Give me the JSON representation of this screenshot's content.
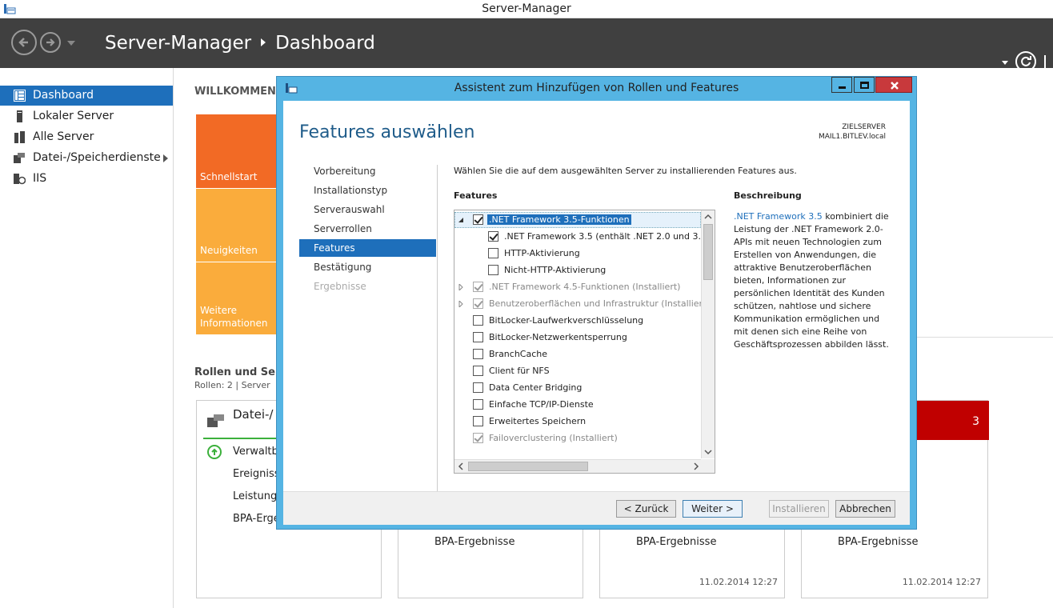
{
  "window": {
    "title": "Server-Manager"
  },
  "header": {
    "breadcrumb_root": "Server-Manager",
    "breadcrumb_page": "Dashboard"
  },
  "sidebar": {
    "items": [
      {
        "label": "Dashboard",
        "icon": "dashboard-icon",
        "active": true
      },
      {
        "label": "Lokaler Server",
        "icon": "server-icon"
      },
      {
        "label": "Alle Server",
        "icon": "servers-icon"
      },
      {
        "label": "Datei-/Speicherdienste",
        "icon": "storage-icon",
        "has_submenu": true
      },
      {
        "label": "IIS",
        "icon": "iis-icon"
      }
    ]
  },
  "dashboard": {
    "welcome": "WILLKOMMEN",
    "tiles": [
      "Schnellstart",
      "Neuigkeiten",
      "Weitere Informationen"
    ],
    "roles_title": "Rollen und Serv",
    "roles_sub": "Rollen: 2  |  Server",
    "card1": {
      "title": "Datei-/ Speiche",
      "rows": [
        "Verwaltb",
        "Ereigniss",
        "Leistung",
        "BPA-Erge"
      ]
    },
    "cards": [
      {
        "bpa": "BPA-Ergebnisse",
        "date": ""
      },
      {
        "bpa": "BPA-Ergebnisse",
        "date": "11.02.2014 12:27"
      },
      {
        "bpa": "BPA-Ergebnisse",
        "date": "11.02.2014 12:27",
        "badge": "3"
      }
    ]
  },
  "dialog": {
    "title": "Assistent zum Hinzufügen von Rollen und Features",
    "heading": "Features auswählen",
    "target_label": "ZIELSERVER",
    "target_server": "MAIL1.BITLEV.local",
    "steps": [
      "Vorbereitung",
      "Installationstyp",
      "Serverauswahl",
      "Serverrollen",
      "Features",
      "Bestätigung",
      "Ergebnisse"
    ],
    "active_step": "Features",
    "instruction": "Wählen Sie die auf dem ausgewählten Server zu installierenden Features aus.",
    "features_header": "Features",
    "description_header": "Beschreibung",
    "description_link": ".NET Framework 3.5",
    "description_text": " kombiniert die Leistung der .NET Framework 2.0-APIs mit neuen Technologien zum Erstellen von Anwendungen, die attraktive Benutzeroberflächen bieten, Informationen zur persönlichen Identität des Kunden schützen, nahtlose und sichere Kommunikation ermöglichen und mit denen sich eine Reihe von Geschäftsprozessen abbilden lässt.",
    "features": [
      {
        "label": ".NET Framework 3.5-Funktionen",
        "checked": true,
        "level": 0,
        "expander": "expanded",
        "selected": true
      },
      {
        "label": ".NET Framework 3.5 (enthält .NET 2.0 und 3.0)",
        "checked": true,
        "level": 1
      },
      {
        "label": "HTTP-Aktivierung",
        "checked": false,
        "level": 1
      },
      {
        "label": "Nicht-HTTP-Aktivierung",
        "checked": false,
        "level": 1
      },
      {
        "label": ".NET Framework 4.5-Funktionen (Installiert)",
        "checked": true,
        "level": 0,
        "expander": "collapsed",
        "installed": true
      },
      {
        "label": "Benutzeroberflächen und Infrastruktur (Installiert)",
        "checked": true,
        "level": 0,
        "expander": "collapsed",
        "installed": true
      },
      {
        "label": "BitLocker-Laufwerkverschlüsselung",
        "checked": false,
        "level": 0
      },
      {
        "label": "BitLocker-Netzwerkentsperrung",
        "checked": false,
        "level": 0
      },
      {
        "label": "BranchCache",
        "checked": false,
        "level": 0
      },
      {
        "label": "Client für NFS",
        "checked": false,
        "level": 0
      },
      {
        "label": "Data Center Bridging",
        "checked": false,
        "level": 0
      },
      {
        "label": "Einfache TCP/IP-Dienste",
        "checked": false,
        "level": 0
      },
      {
        "label": "Erweitertes Speichern",
        "checked": false,
        "level": 0
      },
      {
        "label": "Failoverclustering (Installiert)",
        "checked": true,
        "level": 0,
        "installed": true
      }
    ],
    "buttons": {
      "back": "< Zurück",
      "next": "Weiter >",
      "install": "Installieren",
      "cancel": "Abbrechen"
    }
  },
  "colors": {
    "accent": "#1e6fbb",
    "header_bg": "#404040",
    "dialog_frame": "#55b4e3",
    "tile_orange": "#f26a25",
    "tile_amber": "#faac3c",
    "alert_red": "#c00000"
  }
}
